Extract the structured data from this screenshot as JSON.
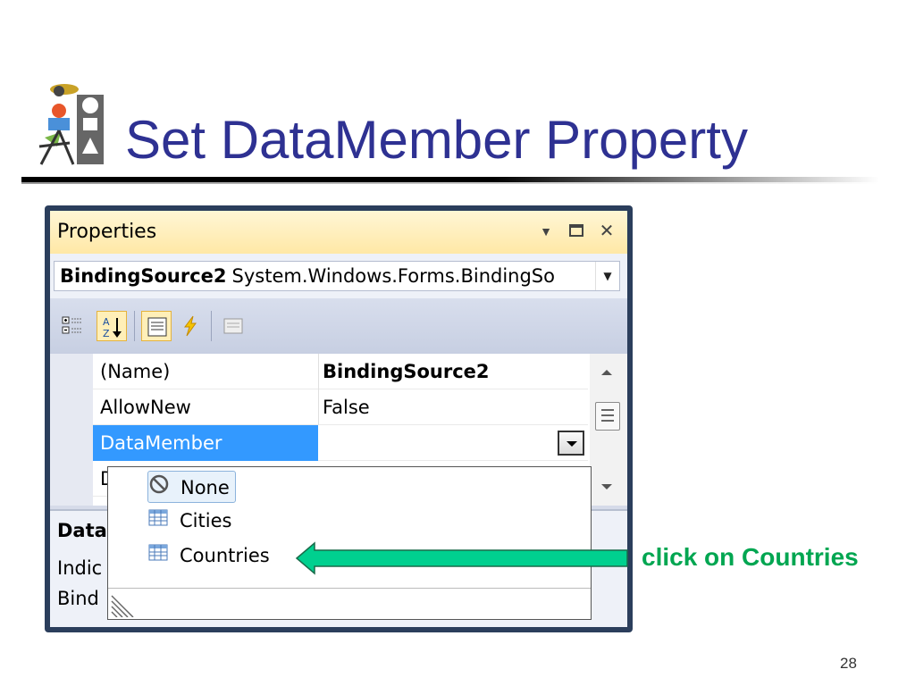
{
  "slide": {
    "title": "Set DataMember Property",
    "page_number": "28",
    "callout_text": "click on Countries",
    "callout_color": "#00a651",
    "title_color": "#2e3192"
  },
  "properties_window": {
    "title": "Properties",
    "title_controls": [
      "dropdown-icon",
      "maximize-icon",
      "close-icon"
    ],
    "object_selector": {
      "name": "BindingSource2",
      "type": "System.Windows.Forms.BindingSo"
    },
    "toolbar": [
      "categorized-icon",
      "alphabetical-icon",
      "properties-icon",
      "events-icon",
      "property-pages-icon"
    ],
    "rows": [
      {
        "name": "(Name)",
        "value": "BindingSource2"
      },
      {
        "name": "AllowNew",
        "value": "False"
      },
      {
        "name": "DataMember",
        "value": ""
      },
      {
        "name": "D",
        "value": ""
      }
    ],
    "description": {
      "title": "Data",
      "line1": "Indic",
      "line2": "Bind"
    }
  },
  "dropdown": {
    "items": [
      {
        "label": "None",
        "icon": "none-icon"
      },
      {
        "label": "Cities",
        "icon": "table-icon"
      },
      {
        "label": "Countries",
        "icon": "table-icon"
      }
    ]
  }
}
